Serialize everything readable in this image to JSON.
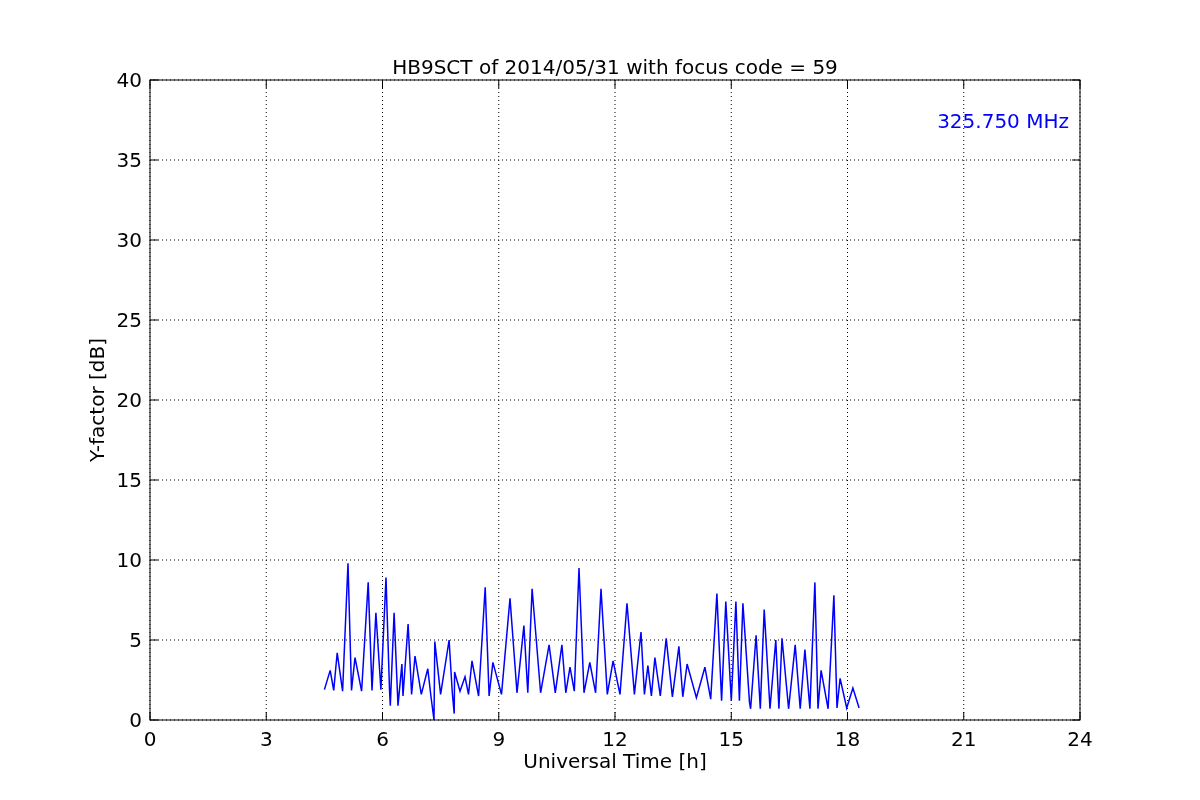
{
  "chart_data": {
    "type": "line",
    "title": "HB9SCT of 2014/05/31 with focus code = 59",
    "xlabel": "Universal Time [h]",
    "ylabel": "Y-factor [dB]",
    "x": [
      4.5,
      4.65,
      4.74,
      4.83,
      4.97,
      5.11,
      5.2,
      5.29,
      5.46,
      5.63,
      5.73,
      5.83,
      5.96,
      6.09,
      6.18,
      6.2,
      6.3,
      6.4,
      6.5,
      6.53,
      6.66,
      6.75,
      6.84,
      7.0,
      7.17,
      7.25,
      7.33,
      7.35,
      7.5,
      7.72,
      7.8,
      7.85,
      7.86,
      8.0,
      8.13,
      8.22,
      8.31,
      8.48,
      8.65,
      8.75,
      8.85,
      9.07,
      9.29,
      9.47,
      9.65,
      9.75,
      9.86,
      10.08,
      10.3,
      10.46,
      10.63,
      10.73,
      10.84,
      10.95,
      11.07,
      11.2,
      11.35,
      11.5,
      11.64,
      11.8,
      11.95,
      12.13,
      12.31,
      12.5,
      12.67,
      12.76,
      12.85,
      12.94,
      13.03,
      13.17,
      13.32,
      13.48,
      13.65,
      13.75,
      13.86,
      14.1,
      14.32,
      14.47,
      14.63,
      14.75,
      14.86,
      15.0,
      15.12,
      15.21,
      15.3,
      15.47,
      15.5,
      15.64,
      15.75,
      15.85,
      16.0,
      16.15,
      16.23,
      16.31,
      16.48,
      16.65,
      16.78,
      16.9,
      17.03,
      17.16,
      17.24,
      17.32,
      17.5,
      17.65,
      17.73,
      17.81,
      17.98,
      18.14,
      18.3
    ],
    "series": [
      {
        "name": "325.750 MHz",
        "color": "#0000ff",
        "values": [
          1.9,
          3.1,
          1.85,
          4.2,
          1.8,
          9.8,
          1.85,
          3.9,
          1.8,
          8.6,
          1.85,
          6.7,
          1.9,
          8.9,
          1.9,
          0.9,
          6.7,
          0.9,
          3.5,
          1.5,
          6.0,
          1.6,
          4.0,
          1.6,
          3.2,
          1.5,
          0,
          4.9,
          1.6,
          5.0,
          1.7,
          0.4,
          3.0,
          1.8,
          2.7,
          1.6,
          3.7,
          1.5,
          8.3,
          1.5,
          3.6,
          1.6,
          7.6,
          1.7,
          5.9,
          1.7,
          8.2,
          1.7,
          4.7,
          1.7,
          4.7,
          1.7,
          3.3,
          1.8,
          9.5,
          1.7,
          3.6,
          1.7,
          8.2,
          1.6,
          3.7,
          1.6,
          7.3,
          1.6,
          5.5,
          1.6,
          3.4,
          1.5,
          3.9,
          1.5,
          5.1,
          1.45,
          4.6,
          1.45,
          3.5,
          1.4,
          3.3,
          1.3,
          7.9,
          1.2,
          7.4,
          1.2,
          7.4,
          1.2,
          7.3,
          1.1,
          0.7,
          5.3,
          0.7,
          6.9,
          0.7,
          5.0,
          0.7,
          5.1,
          0.7,
          4.7,
          0.7,
          4.4,
          0.7,
          8.6,
          0.7,
          3.1,
          0.7,
          7.8,
          0.75,
          2.6,
          0.75,
          2.0,
          0.75
        ]
      }
    ],
    "xlim": [
      0,
      24
    ],
    "ylim": [
      0,
      40
    ],
    "xticks": [
      0,
      3,
      6,
      9,
      12,
      15,
      18,
      21,
      24
    ],
    "yticks": [
      0,
      5,
      10,
      15,
      20,
      25,
      30,
      35,
      40
    ],
    "grid": true
  }
}
